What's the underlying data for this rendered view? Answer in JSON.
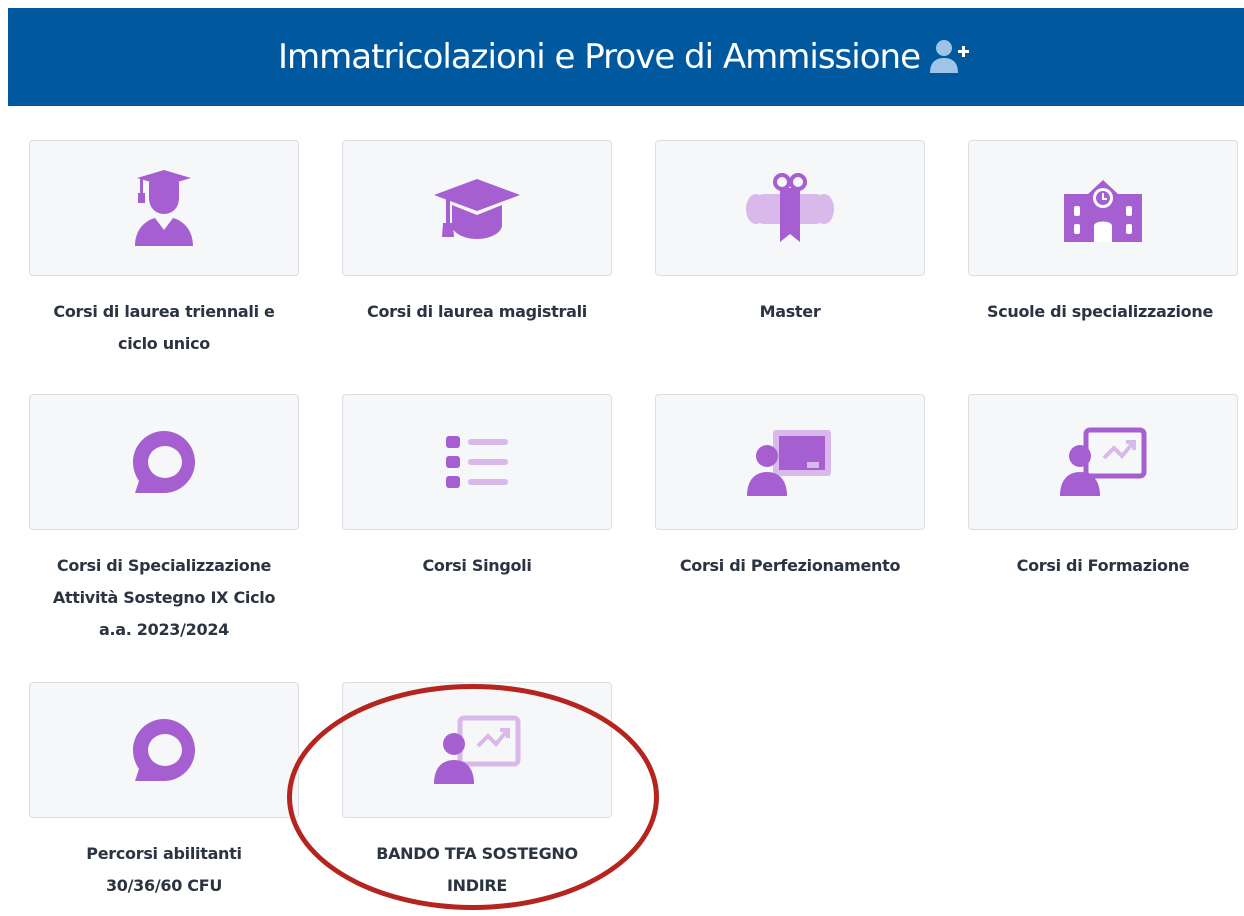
{
  "header": {
    "title": "Immatricolazioni e Prove di Ammissione",
    "icon": "user-plus-icon",
    "background": "#00599f"
  },
  "accent_color": "#a65fd1",
  "accent_light": "#d9b8eb",
  "tiles": [
    {
      "line1": "Corsi di laurea triennali e",
      "line2": "ciclo unico",
      "line3": "",
      "icon": "graduate-student-icon"
    },
    {
      "line1": "Corsi di laurea magistrali",
      "line2": "",
      "line3": "",
      "icon": "graduation-cap-icon"
    },
    {
      "line1": "Master",
      "line2": "",
      "line3": "",
      "icon": "diploma-scroll-icon"
    },
    {
      "line1": "Scuole di specializzazione",
      "line2": "",
      "line3": "",
      "icon": "school-building-icon"
    },
    {
      "line1": "Corsi di Specializzazione",
      "line2": "Attività Sostegno IX Ciclo",
      "line3": "a.a. 2023/2024",
      "icon": "speech-bubble-icon"
    },
    {
      "line1": "Corsi Singoli",
      "line2": "",
      "line3": "",
      "icon": "list-icon"
    },
    {
      "line1": "Corsi di Perfezionamento",
      "line2": "",
      "line3": "",
      "icon": "teacher-board-icon"
    },
    {
      "line1": "Corsi di Formazione",
      "line2": "",
      "line3": "",
      "icon": "presentation-chart-icon"
    },
    {
      "line1": "Percorsi abilitanti",
      "line2": "30/36/60 CFU",
      "line3": "",
      "icon": "speech-bubble-icon"
    },
    {
      "line1": "BANDO TFA SOSTEGNO",
      "line2": "INDIRE",
      "line3": "",
      "icon": "presentation-chart-icon"
    }
  ]
}
